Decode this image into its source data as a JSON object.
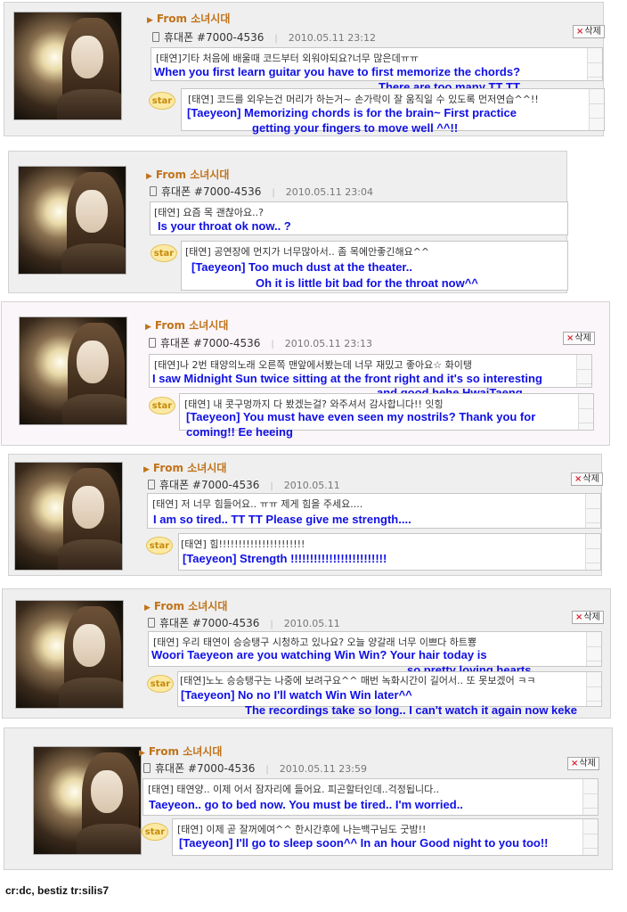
{
  "from_label": "From 소녀시대",
  "phone_label": "휴대폰 #7000-4536",
  "delete_label": "삭제",
  "star_label": "star",
  "posts": [
    {
      "date": "2010.05.11 23:12",
      "question_ko": "[태연]기타 처음에 배울때 코드부터 외워야되요?너무 많은데ㅠㅠ",
      "question_en": [
        "When you first learn guitar you have to first memorize the chords?",
        "There are too many TT TT"
      ],
      "reply_ko": "[태연] 코드를 외우는건 머리가 하는거~ 손가락이 잘 움직일 수 있도록 먼저연습^^!!",
      "reply_en": [
        "[Taeyeon] Memorizing chords is for the brain~ First practice",
        "getting your fingers to move well ^^!!"
      ]
    },
    {
      "date": "2010.05.11 23:04",
      "question_ko": "[태연] 요즘 목 괜찮아요..?",
      "question_en": [
        "Is your throat ok now.. ?"
      ],
      "reply_ko": "[태연] 공연장에 먼지가 너무많아서.. 좀 목에안좋긴해요^^",
      "reply_en": [
        "[Taeyeon] Too much dust at the theater..",
        "Oh it is little bit bad for the throat now^^"
      ]
    },
    {
      "date": "2010.05.11 23:13",
      "question_ko": "[태연]나 2번 태양의노래 오른쪽 맨앞에서봤는데 너무 재밌고 좋아요☆ 화이탱",
      "question_en": [
        "I saw Midnight Sun twice sitting at the front right and it's so interesting",
        "and good hehe HwaiTaeng"
      ],
      "reply_ko": "[태연] 내 콧구멍까지 다 봤겠는걸? 와주셔서 감사합니다!! 잇힝",
      "reply_en": [
        "[Taeyeon] You must have even seen my nostrils? Thank you for",
        "coming!! Ee heeing"
      ]
    },
    {
      "date": "2010.05.11",
      "question_ko": "[태연] 저 너무 힘들어요.. ㅠㅠ 제게 힘을 주세요....",
      "question_en": [
        "I am so tired.. TT  TT  Please give me strength...."
      ],
      "reply_ko": "[태연] 힘!!!!!!!!!!!!!!!!!!!!!!",
      "reply_en": [
        "[Taeyeon] Strength !!!!!!!!!!!!!!!!!!!!!!!!!"
      ]
    },
    {
      "date": "2010.05.11",
      "question_ko": "[태연] 우리 태연이 승승탱구 시청하고 있나요? 오늘 양갈래 너무 이쁘다 하트뿅",
      "question_en": [
        "Woori Taeyeon are you watching Win Win? Your hair today is",
        "so pretty  loving hearts"
      ],
      "reply_ko": "[태연]노노 승승탱구는 나중에 보려구요^^ 매번 녹화시간이 길어서.. 또 못보겠어 ㅋㅋ",
      "reply_en": [
        "[Taeyeon] No no I'll watch Win Win later^^",
        "The recordings take so long.. I can't watch it again now keke"
      ]
    },
    {
      "date": "2010.05.11 23:59",
      "question_ko": "[태연] 태연양.. 이제 어서 잠자리에 들어요. 피곤할터인데..걱정됩니다..",
      "question_en": [
        "Taeyeon.. go to bed now. You must be tired.. I'm worried.."
      ],
      "reply_ko": "[태연] 이제 곧 잘꺼에여^^ 한시간후에 나는백구님도 굿밤!!",
      "reply_en": [
        "[Taeyeon] I'll go to sleep soon^^ In an hour   Good night to you too!!"
      ]
    }
  ],
  "credit": "cr:dc, bestiz  tr:silis7"
}
